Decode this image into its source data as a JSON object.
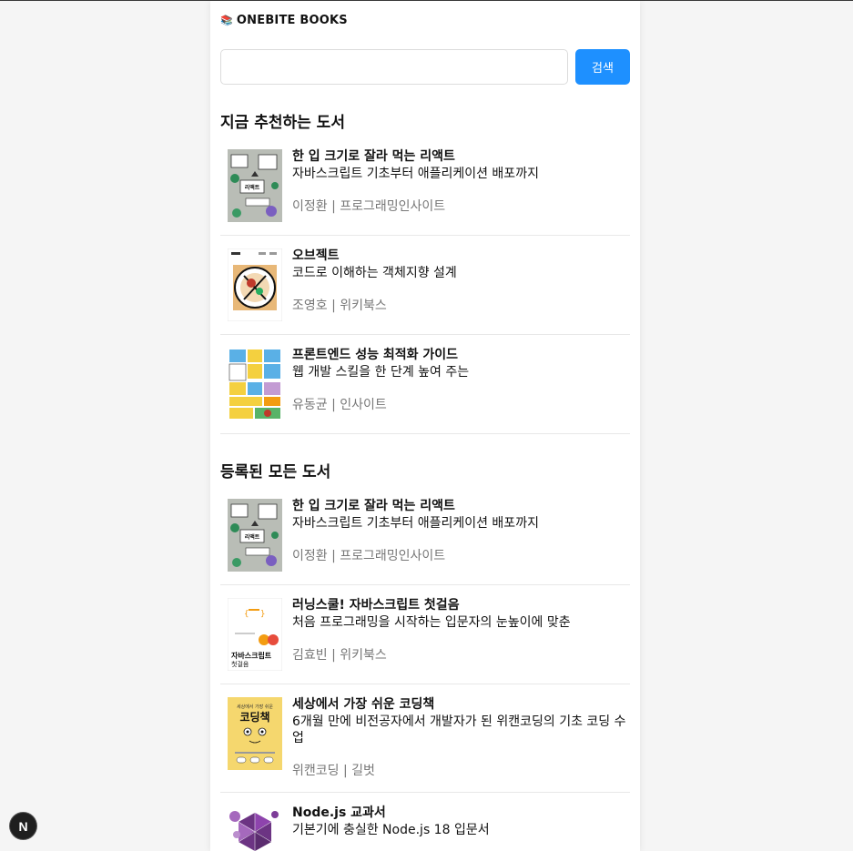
{
  "header": {
    "logo_emoji": "📚",
    "logo_text": "ONEBITE BOOKS"
  },
  "search": {
    "value": "",
    "placeholder": "",
    "button_label": "검색"
  },
  "recommended": {
    "title": "지금 추천하는 도서",
    "books": [
      {
        "title": "한 입 크기로 잘라 먹는 리액트",
        "subtitle": "자바스크립트 기초부터 애플리케이션 배포까지",
        "author": "이정환",
        "publisher": "프로그래밍인사이트",
        "meta": "이정환 | 프로그래밍인사이트",
        "cover": "react-cover"
      },
      {
        "title": "오브젝트",
        "subtitle": "코드로 이해하는 객체지향 설계",
        "author": "조영호",
        "publisher": "위키북스",
        "meta": "조영호 | 위키북스",
        "cover": "object-cover"
      },
      {
        "title": "프론트엔드 성능 최적화 가이드",
        "subtitle": "웹 개발 스킬을 한 단계 높여 주는",
        "author": "유동균",
        "publisher": "인사이트",
        "meta": "유동균 | 인사이트",
        "cover": "frontend-cover"
      }
    ]
  },
  "all": {
    "title": "등록된 모든 도서",
    "books": [
      {
        "title": "한 입 크기로 잘라 먹는 리액트",
        "subtitle": "자바스크립트 기초부터 애플리케이션 배포까지",
        "meta": "이정환 | 프로그래밍인사이트",
        "cover": "react-cover"
      },
      {
        "title": "러닝스쿨! 자바스크립트 첫걸음",
        "subtitle": "처음 프로그래밍을 시작하는 입문자의 눈높이에 맞춘",
        "meta": "김효빈 | 위키북스",
        "cover": "js-cover"
      },
      {
        "title": "세상에서 가장 쉬운 코딩책",
        "subtitle": "6개월 만에 비전공자에서 개발자가 된 위캔코딩의 기초 코딩 수업",
        "meta": "위캔코딩 | 길벗",
        "cover": "coding-cover"
      },
      {
        "title": "Node.js 교과서",
        "subtitle": "기본기에 충실한 Node.js 18 입문서",
        "meta": "",
        "cover": "node-cover"
      }
    ]
  },
  "cover_text": {
    "react": "리액트",
    "js": "자바스크립트",
    "js_sub": "첫걸음",
    "coding_top": "세상에서 가장 쉬운",
    "coding_main": "코딩책"
  },
  "dev_badge": {
    "label": "N"
  },
  "colors": {
    "accent": "#1e90ff",
    "muted": "#777777",
    "border": "#e8e8e8"
  }
}
